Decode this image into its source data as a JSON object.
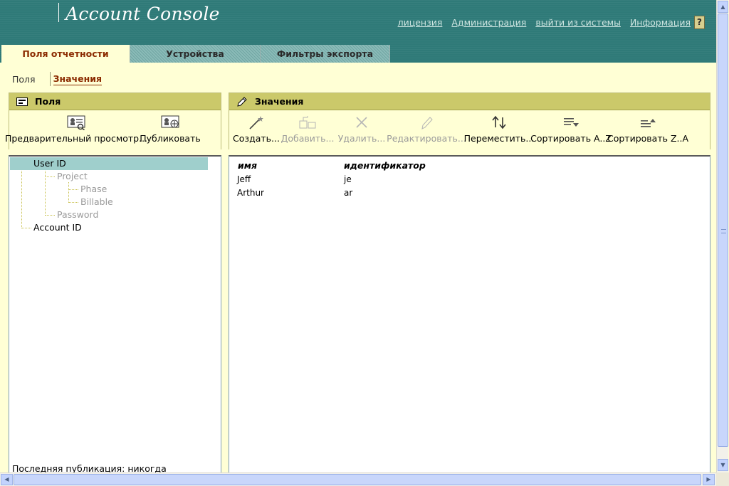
{
  "header": {
    "app_title": "Account Console",
    "links": [
      "лицензия",
      "Администрация",
      "выйти из системы",
      "Информация"
    ],
    "help_label": "?"
  },
  "tabs": [
    {
      "label": "Поля отчетности",
      "active": true
    },
    {
      "label": "Устройства",
      "active": false
    },
    {
      "label": "Фильтры экспорта",
      "active": false
    }
  ],
  "subnav": {
    "fields": "Поля",
    "values": "Значения"
  },
  "left_panel": {
    "title": "Поля",
    "buttons": [
      {
        "label": "Предварительный просмотр...",
        "icon": "preview-icon"
      },
      {
        "label": "Публиковать",
        "icon": "publish-icon"
      }
    ]
  },
  "right_panel": {
    "title": "Значения",
    "buttons": [
      {
        "label": "Создать...",
        "icon": "create-icon",
        "enabled": true
      },
      {
        "label": "Добавить...",
        "icon": "add-icon",
        "enabled": false
      },
      {
        "label": "Удалить...",
        "icon": "delete-icon",
        "enabled": false
      },
      {
        "label": "Редактировать...",
        "icon": "edit-icon",
        "enabled": false
      },
      {
        "label": "Переместить...",
        "icon": "move-icon",
        "enabled": true
      },
      {
        "label": "Сортировать A..Z",
        "icon": "sort-asc-icon",
        "enabled": true
      },
      {
        "label": "Сортировать Z..A",
        "icon": "sort-desc-icon",
        "enabled": true
      }
    ]
  },
  "tree": {
    "nodes": [
      {
        "label": "User ID",
        "selected": true,
        "enabled": true
      },
      {
        "label": "Project",
        "enabled": false
      },
      {
        "label": "Phase",
        "enabled": false
      },
      {
        "label": "Billable",
        "enabled": false
      },
      {
        "label": "Password",
        "enabled": false
      },
      {
        "label": "Account ID",
        "enabled": true
      }
    ],
    "last_published": "Последняя публикация: никогда"
  },
  "values_table": {
    "columns": [
      "имя",
      "идентификатор"
    ],
    "rows": [
      [
        "Jeff",
        "je"
      ],
      [
        "Arthur",
        "ar"
      ]
    ]
  },
  "colors": {
    "header": "#2f7a78",
    "background": "#ffffd5",
    "panel_header": "#cbc96a",
    "active_tab_text": "#8b2b00",
    "selection": "#9fcfcc"
  }
}
